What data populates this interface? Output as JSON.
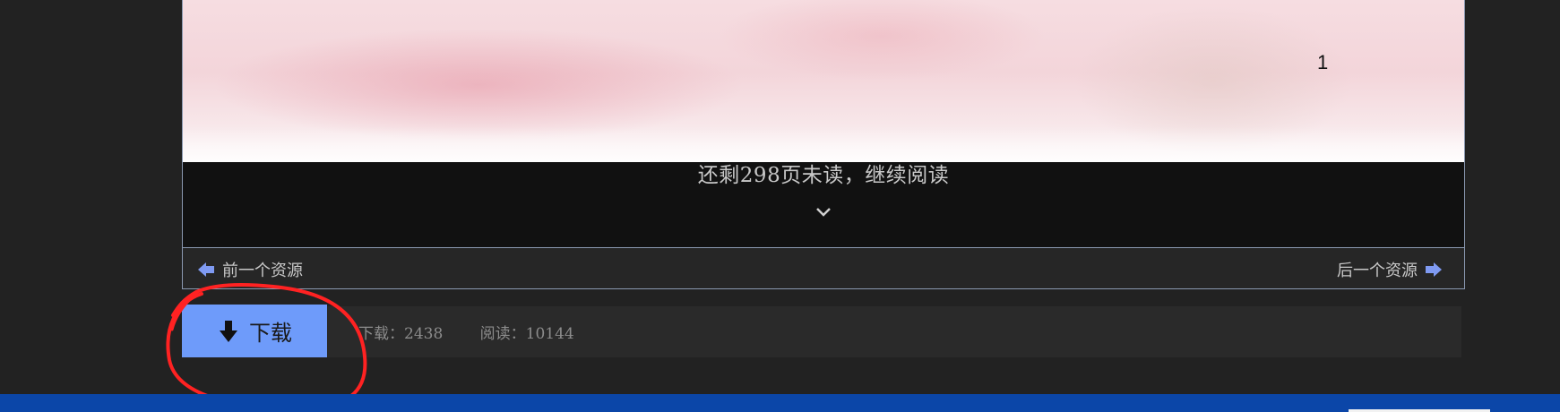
{
  "viewer": {
    "page_number": "1",
    "continue_reading_text": "还剩298页未读，继续阅读",
    "expand_icon": "chevron-down-icon",
    "prev_label": "前一个资源",
    "prev_icon": "arrow-left-icon",
    "next_label": "后一个资源",
    "next_icon": "arrow-right-icon"
  },
  "actions": {
    "download_label": "下载",
    "download_icon": "download-arrow-icon",
    "download_count_text": "下载：2438",
    "read_count_text": "阅读：10144"
  },
  "colors": {
    "download_button": "#6e9bfa",
    "nav_arrow": "#7f9af2",
    "annotation": "#ff2222",
    "footer": "#0b46a8"
  }
}
